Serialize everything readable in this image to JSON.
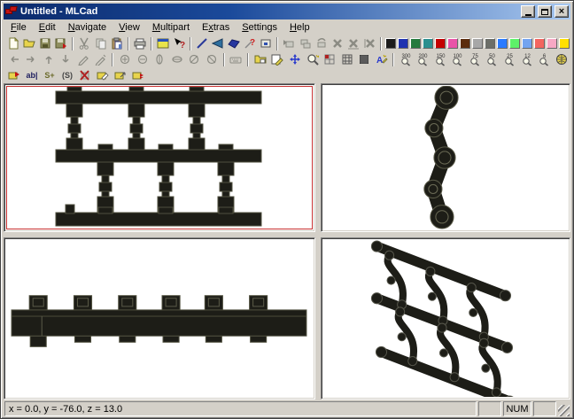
{
  "window": {
    "title": "Untitled - MLCad",
    "controls": [
      "minimize",
      "maximize",
      "close"
    ]
  },
  "menu": {
    "items": [
      {
        "name": "file",
        "label": "File",
        "accel": 0
      },
      {
        "name": "edit",
        "label": "Edit",
        "accel": 0
      },
      {
        "name": "navigate",
        "label": "Navigate",
        "accel": 0
      },
      {
        "name": "view",
        "label": "View",
        "accel": 0
      },
      {
        "name": "multipart",
        "label": "Multipart",
        "accel": 0
      },
      {
        "name": "extras",
        "label": "Extras",
        "accel": 1
      },
      {
        "name": "settings",
        "label": "Settings",
        "accel": 0
      },
      {
        "name": "help",
        "label": "Help",
        "accel": 0
      }
    ]
  },
  "toolbar1": {
    "icons": [
      "new",
      "open",
      "save",
      "save-as",
      "cut",
      "copy",
      "paste",
      "print",
      "system-info",
      "help",
      "draw-line",
      "draw-triangle",
      "draw-quad",
      "draw-optional-line",
      "draw-box",
      "insert-part",
      "hide-part",
      "show-part",
      "delete",
      "delete-step",
      "delete-group"
    ]
  },
  "palette": {
    "colors": [
      "#1c1c1c",
      "#2033b0",
      "#257a3e",
      "#2c8f8f",
      "#c40000",
      "#e953a8",
      "#5b2c0d",
      "#a7a7a7",
      "#6c6e68",
      "#2a7aff",
      "#5df269",
      "#74a4f0",
      "#f3655f",
      "#f8a8c4",
      "#ffe000"
    ]
  },
  "toolbar2": {
    "icons": [
      "move-left",
      "move-right",
      "move-up",
      "move-down",
      "snap",
      "snap-fine",
      "rotate-x-plus",
      "rotate-x-minus",
      "rotate-y-plus",
      "rotate-y-minus",
      "rotate-z-plus",
      "rotate-z-minus",
      "keyboard-entry",
      "parts-tree",
      "select-mode",
      "move-mode",
      "zoom-mode",
      "coarse-grid",
      "medium-grid",
      "fine-grid",
      "draw-to-selection",
      "zoom-fit"
    ],
    "zoom_levels": [
      "300",
      "200",
      "150",
      "100",
      "75",
      "50",
      "25",
      "12",
      "6"
    ]
  },
  "toolbar3": {
    "icons": [
      "insert-comment",
      "insert-text",
      "insert-step",
      "insert-rotation-step",
      "clear-command",
      "edit-command",
      "rotate-command",
      "buffer-exchange"
    ],
    "text_glyph": "ab|",
    "step_glyph": "S+",
    "rotstep_glyph": "(S)"
  },
  "statusbar": {
    "coordinates": "x = 0.0, y = -76.0, z = 13.0",
    "num": "NUM"
  }
}
